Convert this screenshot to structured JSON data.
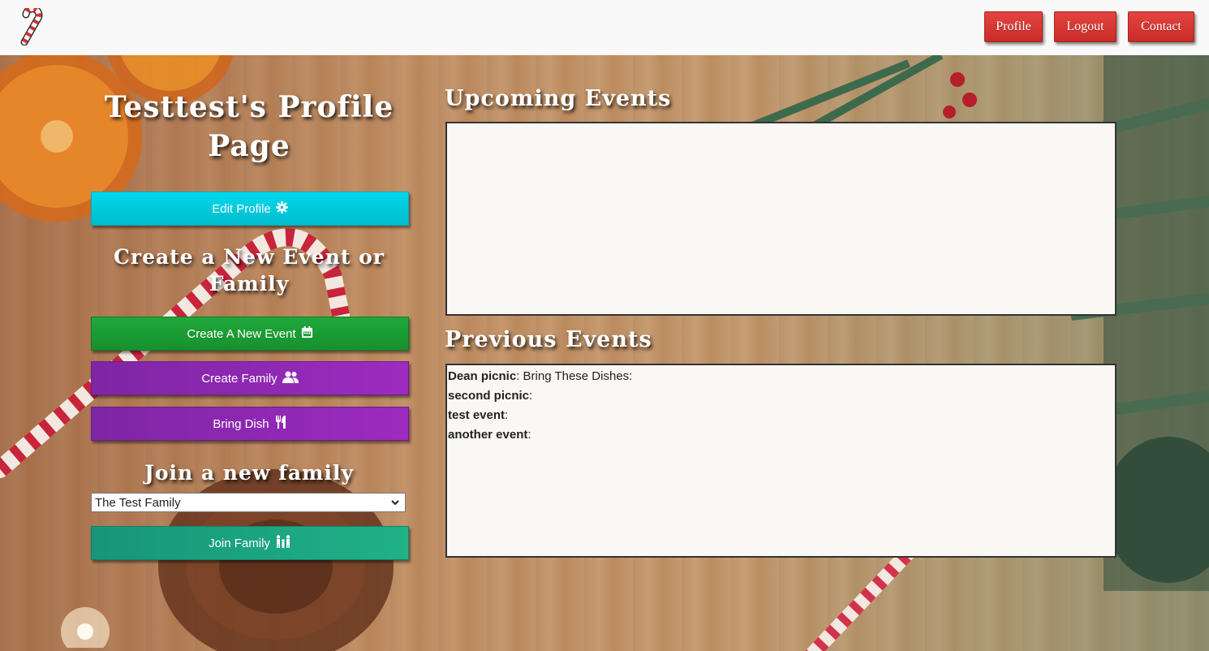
{
  "nav": {
    "profile_label": "Profile",
    "logout_label": "Logout",
    "contact_label": "Contact",
    "logo_icon": "candy-cane-icon"
  },
  "profile": {
    "title": "Testtest's Profile Page",
    "edit_profile_label": "Edit Profile",
    "edit_icon": "gear-icon",
    "create_heading": "Create a New Event or Family",
    "create_event_label": "Create A New Event",
    "create_event_icon": "calendar-icon",
    "create_family_label": "Create Family",
    "create_family_icon": "users-icon",
    "bring_dish_label": "Bring Dish",
    "bring_dish_icon": "utensils-icon",
    "join_heading": "Join a new family",
    "family_select_value": "The Test Family",
    "join_family_label": "Join Family",
    "join_family_icon": "family-icon"
  },
  "events": {
    "upcoming_title": "Upcoming Events",
    "upcoming": [],
    "previous_title": "Previous Events",
    "previous": [
      {
        "name": "Dean picnic",
        "detail": ": Bring These Dishes:"
      },
      {
        "name": "second picnic",
        "detail": ":"
      },
      {
        "name": "test event",
        "detail": ":"
      },
      {
        "name": "another event",
        "detail": ":"
      }
    ]
  },
  "colors": {
    "nav_button": "#d93a35",
    "edit_button": "#00cfe0",
    "create_event_button": "#1c9d35",
    "purple_button": "#8e28b1",
    "join_button": "#1aa27f"
  }
}
